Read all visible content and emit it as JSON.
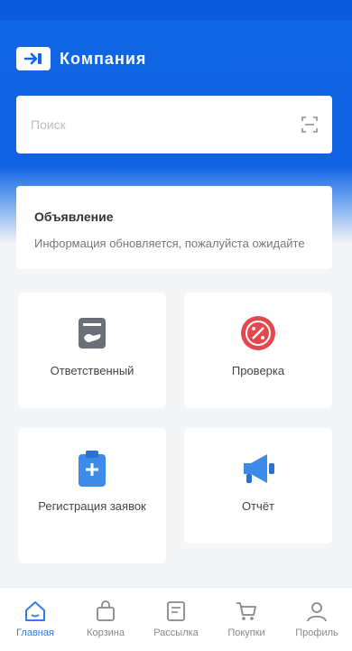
{
  "header": {
    "brand_name": "Компания",
    "brand_logo_icon": "login-arrow-icon"
  },
  "search": {
    "placeholder": "Поиск",
    "scan_icon": "scan-icon"
  },
  "notice": {
    "title": "Объявление",
    "text": "Информация обновляется, пожалуйста ожидайте"
  },
  "tiles": [
    {
      "label": "Ответственный",
      "icon": "document-hand-icon",
      "color": "#6b6f78"
    },
    {
      "label": "Проверка",
      "icon": "percent-badge-icon",
      "color": "#e5474f"
    },
    {
      "label": "Регистрация заявок",
      "icon": "clipboard-add-icon",
      "color": "#3d8be8"
    },
    {
      "label": "Отчёт",
      "icon": "megaphone-icon",
      "color": "#3d8be8"
    }
  ],
  "tabbar": {
    "items": [
      {
        "label": "Главная",
        "icon": "home-icon",
        "active": true
      },
      {
        "label": "Корзина",
        "icon": "bag-icon",
        "active": false
      },
      {
        "label": "Рассылка",
        "icon": "message-icon",
        "active": false
      },
      {
        "label": "Покупки",
        "icon": "cart-icon",
        "active": false
      },
      {
        "label": "Профиль",
        "icon": "user-icon",
        "active": false
      }
    ]
  },
  "colors": {
    "primary": "#1166e6",
    "active_tab": "#2f7de8"
  }
}
